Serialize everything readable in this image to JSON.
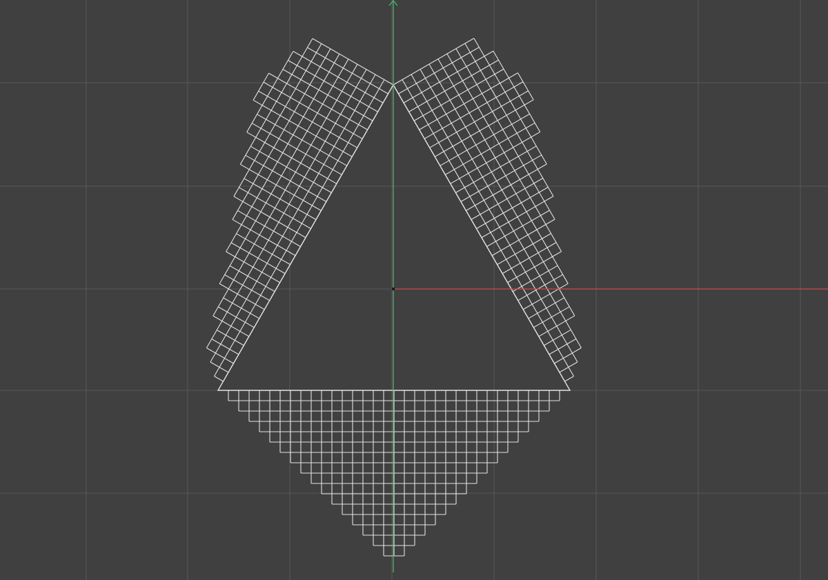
{
  "viewport": {
    "background_color": "#404040",
    "grid_color": "#585858",
    "axis_x_color": "#c94b4b",
    "axis_y_color": "#3fbf6a",
    "mesh_color": "#e4e4e4",
    "origin_marker_color": "#1a1a1a"
  },
  "scene": {
    "objects": [
      {
        "name": "mesh-center-triangle",
        "type": "outline"
      },
      {
        "name": "mesh-top-left-panel",
        "type": "grid"
      },
      {
        "name": "mesh-top-right-panel",
        "type": "grid"
      },
      {
        "name": "mesh-bottom-panel",
        "type": "grid"
      }
    ],
    "icons": [
      "y-axis-arrow-icon",
      "origin-marker-icon"
    ]
  }
}
